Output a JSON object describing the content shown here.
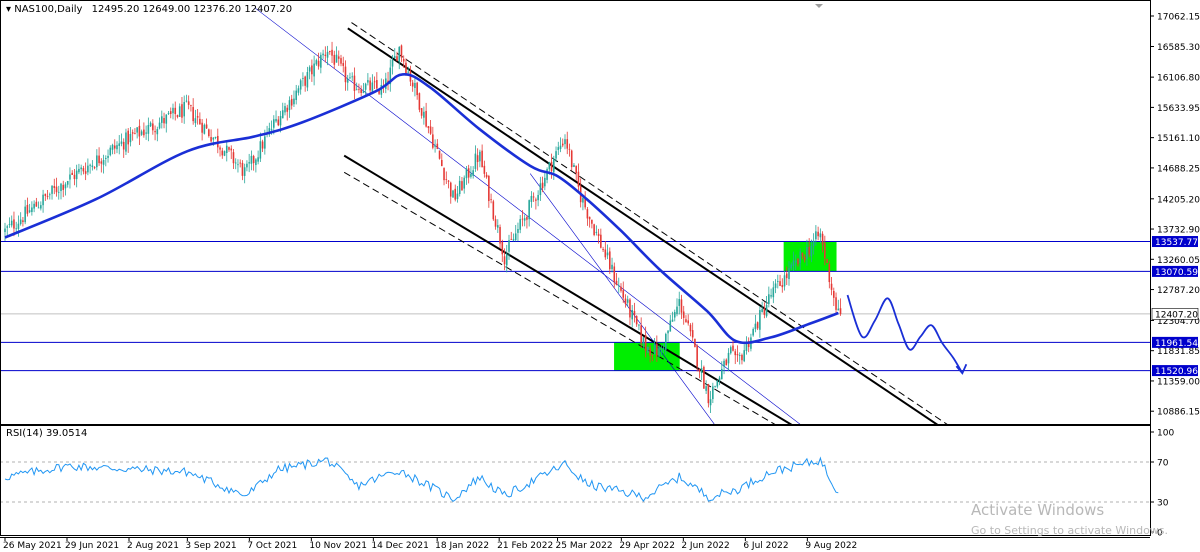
{
  "header": {
    "symbol": "NAS100,Daily",
    "ohlc": "12495.20 12649.00 12376.20 12407.20"
  },
  "rsi_label": "RSI(14) 39.0514",
  "watermark": {
    "title": "Activate Windows",
    "subtitle": "Go to Settings to activate Windows."
  },
  "colors": {
    "bull_candle": "#26a69a",
    "bear_candle": "#e53935",
    "moving_average": "#1a2fd6",
    "level_line": "#0000cc",
    "channel_line": "#000000",
    "projection": "#1a2fd6",
    "zone": "#00ee00",
    "rsi_line": "#2196f3"
  },
  "chart_data": [
    {
      "type": "candlestick",
      "symbol": "NAS100",
      "timeframe": "Daily",
      "last_price": "12407.20",
      "y_ticks": [
        "17062.15",
        "16585.30",
        "16106.80",
        "15633.95",
        "15161.10",
        "14688.25",
        "14205.20",
        "13732.90",
        "13260.05",
        "12787.20",
        "12304.70",
        "11831.85",
        "11359.00",
        "10886.15"
      ],
      "x_ticks": [
        "26 May 2021",
        "29 Jun 2021",
        "2 Aug 2021",
        "3 Sep 2021",
        "7 Oct 2021",
        "10 Nov 2021",
        "14 Dec 2021",
        "18 Jan 2022",
        "21 Feb 2022",
        "25 Mar 2022",
        "29 Apr 2022",
        "2 Jun 2022",
        "6 Jul 2022",
        "9 Aug 2022"
      ],
      "levels": [
        {
          "label": "13537.77",
          "value": 13537.77
        },
        {
          "label": "13070.59",
          "value": 13070.59
        },
        {
          "label": "11961.54",
          "value": 11961.54
        },
        {
          "label": "11520.96",
          "value": 11520.96
        }
      ],
      "close_path": [
        {
          "date": "2021-05-26",
          "close": 13700
        },
        {
          "date": "2021-06-29",
          "close": 14500
        },
        {
          "date": "2021-08-02",
          "close": 15150
        },
        {
          "date": "2021-09-03",
          "close": 15620
        },
        {
          "date": "2021-10-05",
          "close": 14600
        },
        {
          "date": "2021-10-22",
          "close": 15450
        },
        {
          "date": "2021-11-19",
          "close": 16550
        },
        {
          "date": "2021-12-01",
          "close": 16000
        },
        {
          "date": "2021-12-20",
          "close": 15900
        },
        {
          "date": "2021-12-28",
          "close": 16580
        },
        {
          "date": "2022-01-06",
          "close": 15900
        },
        {
          "date": "2022-01-27",
          "close": 14200
        },
        {
          "date": "2022-02-10",
          "close": 14900
        },
        {
          "date": "2022-02-24",
          "close": 13300
        },
        {
          "date": "2022-03-29",
          "close": 15180
        },
        {
          "date": "2022-04-06",
          "close": 14300
        },
        {
          "date": "2022-04-25",
          "close": 13000
        },
        {
          "date": "2022-05-12",
          "close": 11900
        },
        {
          "date": "2022-05-20",
          "close": 11800
        },
        {
          "date": "2022-05-31",
          "close": 12600
        },
        {
          "date": "2022-06-16",
          "close": 11100
        },
        {
          "date": "2022-06-28",
          "close": 11800
        },
        {
          "date": "2022-07-01",
          "close": 11600
        },
        {
          "date": "2022-07-20",
          "close": 12700
        },
        {
          "date": "2022-08-16",
          "close": 13650
        },
        {
          "date": "2022-08-24",
          "close": 12600
        },
        {
          "date": "2022-08-26",
          "close": 12407.2
        }
      ],
      "moving_average": [
        {
          "date": "2021-05-26",
          "value": 13600
        },
        {
          "date": "2021-07-15",
          "value": 14200
        },
        {
          "date": "2021-09-03",
          "value": 14950
        },
        {
          "date": "2021-10-10",
          "value": 15180
        },
        {
          "date": "2021-11-05",
          "value": 15400
        },
        {
          "date": "2021-12-15",
          "value": 15880
        },
        {
          "date": "2021-12-30",
          "value": 16150
        },
        {
          "date": "2022-01-14",
          "value": 15950
        },
        {
          "date": "2022-02-10",
          "value": 15300
        },
        {
          "date": "2022-03-10",
          "value": 14720
        },
        {
          "date": "2022-03-25",
          "value": 14560
        },
        {
          "date": "2022-04-10",
          "value": 14200
        },
        {
          "date": "2022-04-29",
          "value": 13700
        },
        {
          "date": "2022-05-20",
          "value": 13100
        },
        {
          "date": "2022-06-15",
          "value": 12450
        },
        {
          "date": "2022-07-01",
          "value": 11980
        },
        {
          "date": "2022-07-20",
          "value": 12040
        },
        {
          "date": "2022-08-10",
          "value": 12250
        },
        {
          "date": "2022-08-26",
          "value": 12420
        }
      ],
      "rsi": {
        "period": 14,
        "last": 39.0514,
        "y_ticks": [
          100,
          70,
          30,
          0
        ],
        "reference_levels": [
          70,
          30
        ],
        "series": [
          {
            "date": "2021-05-26",
            "value": 55
          },
          {
            "date": "2021-06-29",
            "value": 66
          },
          {
            "date": "2021-08-02",
            "value": 63
          },
          {
            "date": "2021-09-03",
            "value": 60
          },
          {
            "date": "2021-10-05",
            "value": 36
          },
          {
            "date": "2021-10-22",
            "value": 62
          },
          {
            "date": "2021-11-19",
            "value": 72
          },
          {
            "date": "2021-12-05",
            "value": 46
          },
          {
            "date": "2021-12-28",
            "value": 62
          },
          {
            "date": "2022-01-27",
            "value": 33
          },
          {
            "date": "2022-02-10",
            "value": 55
          },
          {
            "date": "2022-02-24",
            "value": 36
          },
          {
            "date": "2022-03-29",
            "value": 68
          },
          {
            "date": "2022-04-10",
            "value": 48
          },
          {
            "date": "2022-05-12",
            "value": 35
          },
          {
            "date": "2022-05-31",
            "value": 55
          },
          {
            "date": "2022-06-16",
            "value": 35
          },
          {
            "date": "2022-07-01",
            "value": 42
          },
          {
            "date": "2022-07-20",
            "value": 60
          },
          {
            "date": "2022-08-16",
            "value": 72
          },
          {
            "date": "2022-08-24",
            "value": 45
          },
          {
            "date": "2022-08-26",
            "value": 39.05
          }
        ]
      }
    }
  ]
}
